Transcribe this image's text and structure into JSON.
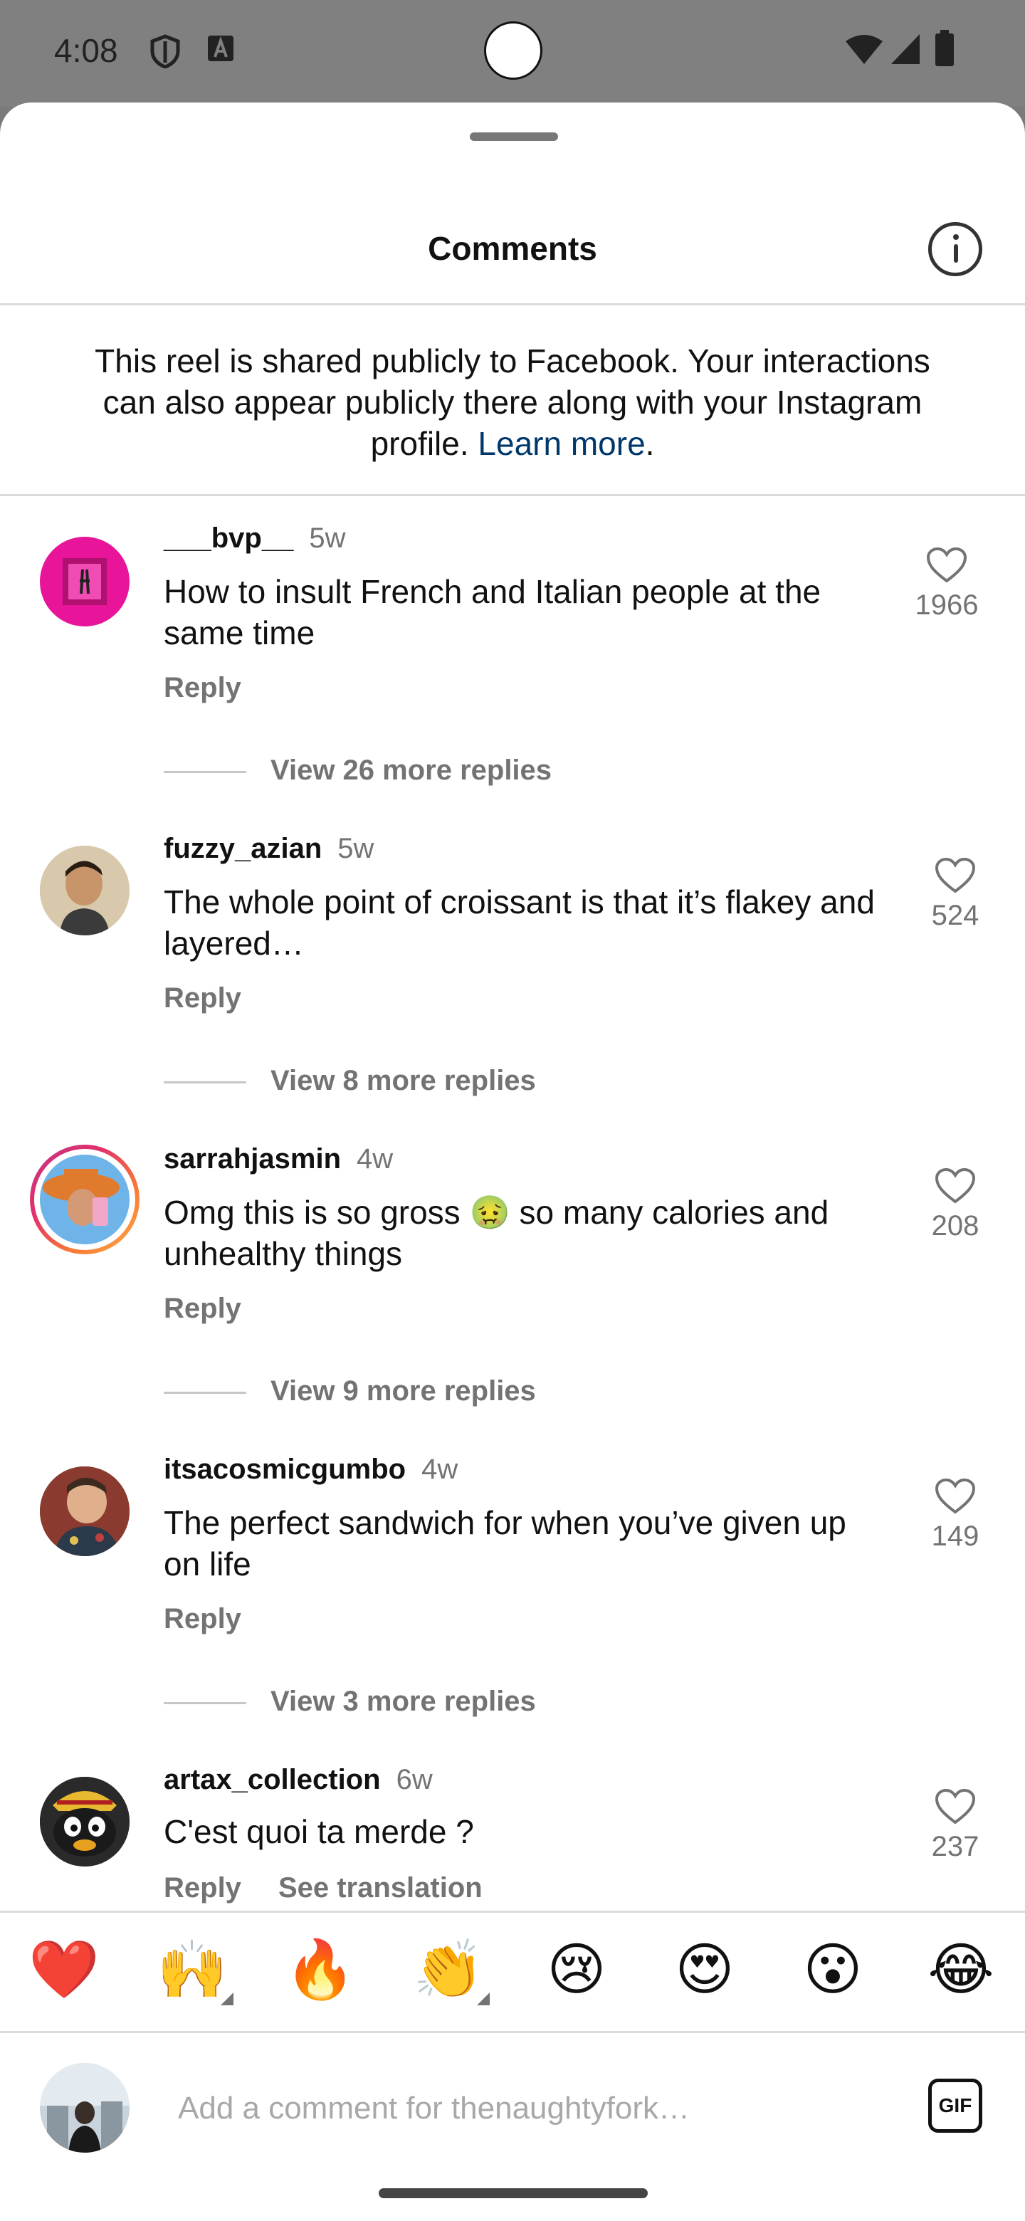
{
  "status_bar": {
    "time": "4:08"
  },
  "sheet": {
    "title": "Comments",
    "notice_text": "This reel is shared publicly to Facebook. Your interactions can also appear publicly there along with your Instagram profile. ",
    "notice_link": "Learn more",
    "notice_end": "."
  },
  "comments": [
    {
      "username": "___bvp__",
      "time": "5w",
      "text": "How to insult French and Italian people at the same time",
      "reply": "Reply",
      "likes": "1966",
      "view_replies": "View 26 more replies"
    },
    {
      "username": "fuzzy_azian",
      "time": "5w",
      "text": "The whole point of croissant is that it’s flakey and layered…",
      "reply": "Reply",
      "likes": "524",
      "view_replies": "View 8 more replies"
    },
    {
      "username": "sarrahjasmin",
      "time": "4w",
      "text_before": "Omg this is so gross ",
      "emoji": "🤢",
      "text_after": " so many calories and unhealthy things",
      "reply": "Reply",
      "likes": "208",
      "view_replies": "View 9 more replies"
    },
    {
      "username": "itsacosmicgumbo",
      "time": "4w",
      "text": "The perfect sandwich for when you’ve given up on life",
      "reply": "Reply",
      "likes": "149",
      "view_replies": "View 3 more replies"
    },
    {
      "username": "artax_collection",
      "time": "6w",
      "text": "C'est quoi ta merde ?",
      "reply": "Reply",
      "translate": "See translation",
      "likes": "237"
    }
  ],
  "emoji_bar": [
    "❤️",
    "🙌",
    "🔥",
    "👏",
    "😢",
    "😍",
    "😮",
    "😂"
  ],
  "compose": {
    "placeholder": "Add a comment for thenaughtyfork…",
    "gif_label": "GIF"
  },
  "colors": {
    "link": "#00376b",
    "meta_gray": "#737373",
    "divider": "#dbdbdb"
  }
}
